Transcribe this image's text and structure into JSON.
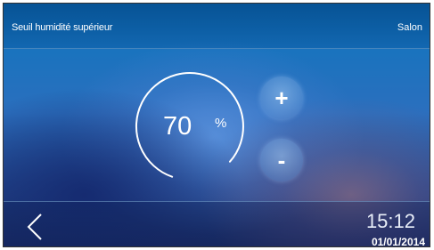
{
  "header": {
    "title": "Seuil humidité supérieur",
    "room": "Salon"
  },
  "setpoint": {
    "value": "70",
    "unit": "%",
    "gauge_fraction": 0.7
  },
  "controls": {
    "increase_label": "+",
    "decrease_label": "-"
  },
  "footer": {
    "time": "15:12",
    "date": "01/01/2014"
  },
  "icons": {
    "back": "chevron-left-icon"
  },
  "colors": {
    "text": "#ffffff",
    "background": "#1a73be"
  }
}
